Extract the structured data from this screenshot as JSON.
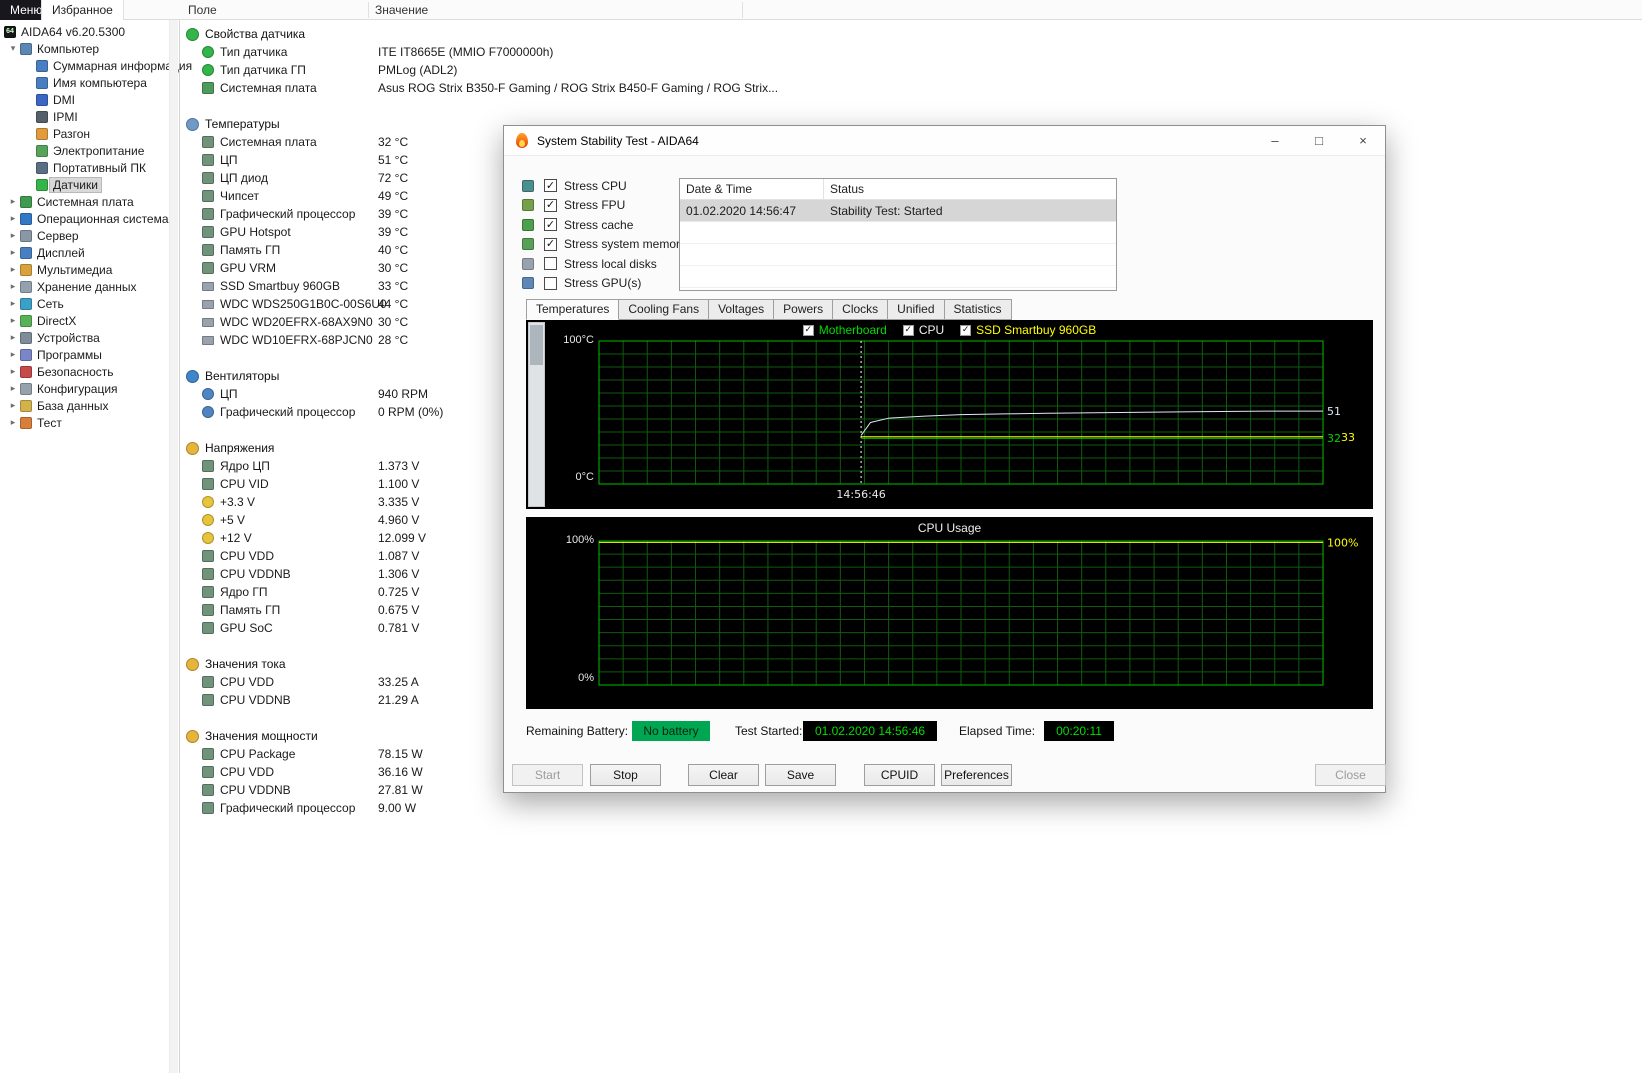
{
  "menu": {
    "menu_label": "Меню",
    "favorites_label": "Избранное"
  },
  "tree": {
    "items": [
      {
        "label": "AIDA64 v6.20.5300",
        "cls": "lvl0",
        "arrow": "",
        "icon": "aida64-logo-icon",
        "icon_color": "#151515",
        "glyph": "64"
      },
      {
        "label": "Компьютер",
        "cls": "lvl1",
        "arrow": "▾",
        "icon": "computer-icon",
        "icon_color": "#5b87b5"
      },
      {
        "label": "Суммарная информация",
        "cls": "lvl2",
        "arrow": "",
        "icon": "summary-icon",
        "icon_color": "#4a7ec2"
      },
      {
        "label": "Имя компьютера",
        "cls": "lvl2",
        "arrow": "",
        "icon": "computer-name-icon",
        "icon_color": "#4a7ec2"
      },
      {
        "label": "DMI",
        "cls": "lvl2",
        "arrow": "",
        "icon": "dmi-icon",
        "icon_color": "#3b66c4"
      },
      {
        "label": "IPMI",
        "cls": "lvl2",
        "arrow": "",
        "icon": "ipmi-icon",
        "icon_color": "#56606a"
      },
      {
        "label": "Разгон",
        "cls": "lvl2",
        "arrow": "",
        "icon": "overclock-icon",
        "icon_color": "#e09b3d"
      },
      {
        "label": "Электропитание",
        "cls": "lvl2",
        "arrow": "",
        "icon": "power-supply-icon",
        "icon_color": "#57a35c"
      },
      {
        "label": "Портативный ПК",
        "cls": "lvl2",
        "arrow": "",
        "icon": "laptop-icon",
        "icon_color": "#5a6f86"
      },
      {
        "label": "Датчики",
        "cls": "lvl2 selected",
        "arrow": "",
        "icon": "sensors-icon",
        "icon_color": "#35b44a"
      },
      {
        "label": "Системная плата",
        "cls": "lvl1",
        "arrow": "▸",
        "icon": "motherboard-icon",
        "icon_color": "#3f9b4f"
      },
      {
        "label": "Операционная система",
        "cls": "lvl1",
        "arrow": "▸",
        "icon": "os-icon",
        "icon_color": "#3178c6"
      },
      {
        "label": "Сервер",
        "cls": "lvl1",
        "arrow": "▸",
        "icon": "server-icon",
        "icon_color": "#8a97a5"
      },
      {
        "label": "Дисплей",
        "cls": "lvl1",
        "arrow": "▸",
        "icon": "display-icon",
        "icon_color": "#4a7ec2"
      },
      {
        "label": "Мультимедиа",
        "cls": "lvl1",
        "arrow": "▸",
        "icon": "multimedia-icon",
        "icon_color": "#d9a23c"
      },
      {
        "label": "Хранение данных",
        "cls": "lvl1",
        "arrow": "▸",
        "icon": "storage-icon",
        "icon_color": "#93a1af"
      },
      {
        "label": "Сеть",
        "cls": "lvl1",
        "arrow": "▸",
        "icon": "network-icon",
        "icon_color": "#3ba0c8"
      },
      {
        "label": "DirectX",
        "cls": "lvl1",
        "arrow": "▸",
        "icon": "directx-icon",
        "icon_color": "#58b358"
      },
      {
        "label": "Устройства",
        "cls": "lvl1",
        "arrow": "▸",
        "icon": "devices-icon",
        "icon_color": "#7e8c9a"
      },
      {
        "label": "Программы",
        "cls": "lvl1",
        "arrow": "▸",
        "icon": "programs-icon",
        "icon_color": "#7a86c8"
      },
      {
        "label": "Безопасность",
        "cls": "lvl1",
        "arrow": "▸",
        "icon": "security-icon",
        "icon_color": "#c64a4a"
      },
      {
        "label": "Конфигурация",
        "cls": "lvl1",
        "arrow": "▸",
        "icon": "config-icon",
        "icon_color": "#97a1ab"
      },
      {
        "label": "База данных",
        "cls": "lvl1",
        "arrow": "▸",
        "icon": "database-icon",
        "icon_color": "#d2b24a"
      },
      {
        "label": "Тест",
        "cls": "lvl1",
        "arrow": "▸",
        "icon": "test-icon",
        "icon_color": "#d87e3a"
      }
    ]
  },
  "sensors": {
    "columns": [
      "Поле",
      "Значение"
    ],
    "groups": [
      {
        "label": "Свойства датчика",
        "icon_color": "#35b44a",
        "rows": [
          {
            "label": "Тип датчика",
            "value": "ITE IT8665E  (MMIO F7000000h)",
            "icon_color": "#35b44a",
            "shape": "volt"
          },
          {
            "label": "Тип датчика ГП",
            "value": "PMLog  (ADL2)",
            "icon_color": "#35b44a",
            "shape": "volt"
          },
          {
            "label": "Системная плата",
            "value": "Asus ROG Strix B350-F Gaming / ROG Strix B450-F Gaming / ROG Strix...",
            "icon_color": "#4f9b5f",
            "shape": "chip"
          }
        ]
      },
      {
        "label": "Температуры",
        "icon_color": "#6f9ac8",
        "rows": [
          {
            "label": "Системная плата",
            "value": "32 °C",
            "icon_color": "#71927b",
            "shape": "chip"
          },
          {
            "label": "ЦП",
            "value": "51 °C",
            "icon_color": "#71927b",
            "shape": "chip"
          },
          {
            "label": "ЦП диод",
            "value": "72 °C",
            "icon_color": "#71927b",
            "shape": "chip"
          },
          {
            "label": "Чипсет",
            "value": "49 °C",
            "icon_color": "#71927b",
            "shape": "chip"
          },
          {
            "label": "Графический процессор",
            "value": "39 °C",
            "icon_color": "#71927b",
            "shape": "chip"
          },
          {
            "label": "GPU Hotspot",
            "value": "39 °C",
            "icon_color": "#71927b",
            "shape": "chip"
          },
          {
            "label": "Память ГП",
            "value": "40 °C",
            "icon_color": "#71927b",
            "shape": "chip"
          },
          {
            "label": "GPU VRM",
            "value": "30 °C",
            "icon_color": "#71927b",
            "shape": "chip"
          },
          {
            "label": "SSD Smartbuy 960GB",
            "value": "33 °C",
            "icon_color": "#9aa3ad",
            "shape": "drive"
          },
          {
            "label": "WDC WDS250G1B0C-00S6U0",
            "value": "44 °C",
            "icon_color": "#9aa3ad",
            "shape": "drive"
          },
          {
            "label": "WDC WD20EFRX-68AX9N0",
            "value": "30 °C",
            "icon_color": "#9aa3ad",
            "shape": "drive"
          },
          {
            "label": "WDC WD10EFRX-68PJCN0",
            "value": "28 °C",
            "icon_color": "#9aa3ad",
            "shape": "drive"
          }
        ]
      },
      {
        "label": "Вентиляторы",
        "icon_color": "#3f86c8",
        "rows": [
          {
            "label": "ЦП",
            "value": "940 RPM",
            "icon_color": "#4f86c2",
            "shape": "fan"
          },
          {
            "label": "Графический процессор",
            "value": "0 RPM  (0%)",
            "icon_color": "#4f86c2",
            "shape": "fan"
          }
        ]
      },
      {
        "label": "Напряжения",
        "icon_color": "#e6b33c",
        "rows": [
          {
            "label": "Ядро ЦП",
            "value": "1.373 V",
            "icon_color": "#71927b",
            "shape": "chip"
          },
          {
            "label": "CPU VID",
            "value": "1.100 V",
            "icon_color": "#71927b",
            "shape": "chip"
          },
          {
            "label": "+3.3 V",
            "value": "3.335 V",
            "icon_color": "#e8c43c",
            "shape": "volt"
          },
          {
            "label": "+5 V",
            "value": "4.960 V",
            "icon_color": "#e8c43c",
            "shape": "volt"
          },
          {
            "label": "+12 V",
            "value": "12.099 V",
            "icon_color": "#e8c43c",
            "shape": "volt"
          },
          {
            "label": "CPU VDD",
            "value": "1.087 V",
            "icon_color": "#71927b",
            "shape": "chip"
          },
          {
            "label": "CPU VDDNB",
            "value": "1.306 V",
            "icon_color": "#71927b",
            "shape": "chip"
          },
          {
            "label": "Ядро ГП",
            "value": "0.725 V",
            "icon_color": "#71927b",
            "shape": "chip"
          },
          {
            "label": "Память ГП",
            "value": "0.675 V",
            "icon_color": "#71927b",
            "shape": "chip"
          },
          {
            "label": "GPU SoC",
            "value": "0.781 V",
            "icon_color": "#71927b",
            "shape": "chip"
          }
        ]
      },
      {
        "label": "Значения тока",
        "icon_color": "#e6b33c",
        "rows": [
          {
            "label": "CPU VDD",
            "value": "33.25 A",
            "icon_color": "#71927b",
            "shape": "chip"
          },
          {
            "label": "CPU VDDNB",
            "value": "21.29 A",
            "icon_color": "#71927b",
            "shape": "chip"
          }
        ]
      },
      {
        "label": "Значения мощности",
        "icon_color": "#e6b33c",
        "rows": [
          {
            "label": "CPU Package",
            "value": "78.15 W",
            "icon_color": "#71927b",
            "shape": "chip"
          },
          {
            "label": "CPU VDD",
            "value": "36.16 W",
            "icon_color": "#71927b",
            "shape": "chip"
          },
          {
            "label": "CPU VDDNB",
            "value": "27.81 W",
            "icon_color": "#71927b",
            "shape": "chip"
          },
          {
            "label": "Графический процессор",
            "value": "9.00 W",
            "icon_color": "#71927b",
            "shape": "chip"
          }
        ]
      }
    ]
  },
  "stability": {
    "title": "System Stability Test - AIDA64",
    "window_controls": {
      "minimize": "–",
      "maximize": "□",
      "close": "×"
    },
    "stress_options": [
      {
        "label": "Stress CPU",
        "state": "checked",
        "icon": "cpu-icon",
        "icon_color": "#4c8f8f"
      },
      {
        "label": "Stress FPU",
        "state": "checked",
        "icon": "fpu-icon",
        "icon_color": "#76a04a"
      },
      {
        "label": "Stress cache",
        "state": "checked",
        "icon": "cache-icon",
        "icon_color": "#4d9e4d"
      },
      {
        "label": "Stress system memory",
        "state": "checked",
        "icon": "memory-icon",
        "icon_color": "#58a058"
      },
      {
        "label": "Stress local disks",
        "state": "",
        "icon": "disk-icon",
        "icon_color": "#9aa3ad"
      },
      {
        "label": "Stress GPU(s)",
        "state": "",
        "icon": "gpu-icon",
        "icon_color": "#5f87b5"
      }
    ],
    "log": {
      "columns": [
        "Date & Time",
        "Status"
      ],
      "rows": [
        {
          "datetime": "01.02.2020 14:56:47",
          "status": "Stability Test: Started"
        }
      ]
    },
    "tabs": [
      {
        "label": "Temperatures",
        "cls": "active"
      },
      {
        "label": "Cooling Fans",
        "cls": ""
      },
      {
        "label": "Voltages",
        "cls": ""
      },
      {
        "label": "Powers",
        "cls": ""
      },
      {
        "label": "Clocks",
        "cls": ""
      },
      {
        "label": "Unified",
        "cls": ""
      },
      {
        "label": "Statistics",
        "cls": ""
      }
    ],
    "status_bar": {
      "remaining_battery_label": "Remaining Battery:",
      "remaining_battery": "No battery",
      "test_started_label": "Test Started:",
      "test_started": "01.02.2020 14:56:46",
      "elapsed_label": "Elapsed Time:",
      "elapsed": "00:20:11"
    },
    "buttons": [
      {
        "label": "Start",
        "name": "start-button",
        "cls": "disabled"
      },
      {
        "label": "Stop",
        "name": "stop-button",
        "cls": ""
      },
      {
        "label": "Clear",
        "name": "clear-button",
        "cls": ""
      },
      {
        "label": "Save",
        "name": "save-button",
        "cls": ""
      },
      {
        "label": "CPUID",
        "name": "cpuid-button",
        "cls": ""
      },
      {
        "label": "Preferences",
        "name": "preferences-button",
        "cls": ""
      },
      {
        "label": "Close",
        "name": "close-button-bottom",
        "cls": "disabled"
      }
    ]
  },
  "chart_data": [
    {
      "type": "line",
      "title": "Temperatures",
      "ylim": [
        0,
        100
      ],
      "y_top_label": "100°C",
      "y_bottom_label": "0°C",
      "grid_color": "#0e5c0e",
      "border_color": "#00bf00",
      "event_x": 0.362,
      "event_label": "14:56:46",
      "legend": [
        {
          "name": "Motherboard",
          "color": "#00dc00",
          "checked": true
        },
        {
          "name": "CPU",
          "color": "#f2f2f2",
          "checked": true
        },
        {
          "name": "SSD Smartbuy 960GB",
          "color": "#ffff00",
          "checked": true
        }
      ],
      "series": [
        {
          "name": "Motherboard",
          "color": "#00d000",
          "end_label": "32",
          "points": [
            [
              0.362,
              32
            ],
            [
              0.55,
              32
            ],
            [
              0.75,
              32
            ],
            [
              1,
              32
            ]
          ]
        },
        {
          "name": "CPU",
          "color": "#dce8f4",
          "end_label": "51",
          "points": [
            [
              0.362,
              34
            ],
            [
              0.375,
              43
            ],
            [
              0.4,
              46
            ],
            [
              0.45,
              47.5
            ],
            [
              0.5,
              48.5
            ],
            [
              0.56,
              49
            ],
            [
              0.62,
              49.5
            ],
            [
              0.72,
              50
            ],
            [
              0.82,
              50.5
            ],
            [
              0.92,
              51
            ],
            [
              1,
              51
            ]
          ]
        },
        {
          "name": "SSD Smartbuy 960GB",
          "color": "#ffff00",
          "end_label": "33",
          "points": [
            [
              0.362,
              33
            ],
            [
              0.6,
              33
            ],
            [
              1,
              33
            ]
          ]
        }
      ]
    },
    {
      "type": "line",
      "title": "CPU Usage",
      "ylim": [
        0,
        100
      ],
      "y_top_label": "100%",
      "y_bottom_label": "0%",
      "grid_color": "#0e5c0e",
      "border_color": "#00bf00",
      "series": [
        {
          "name": "CPU Usage",
          "color": "#ffff00",
          "end_label": "100%",
          "points": [
            [
              0,
              100
            ],
            [
              0.5,
              100
            ],
            [
              1,
              100
            ]
          ]
        }
      ]
    }
  ]
}
